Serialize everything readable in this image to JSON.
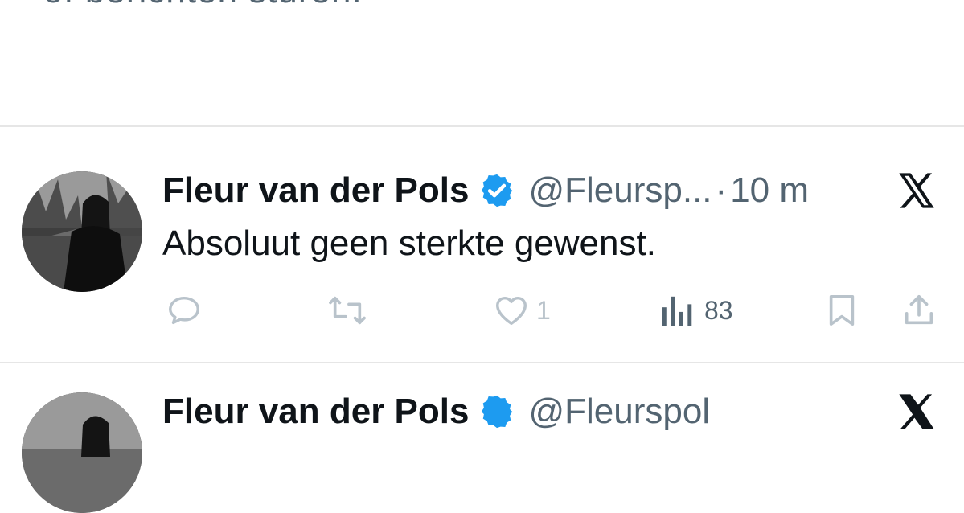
{
  "previous_text": "of berichten sturen.",
  "tweet": {
    "author_name": "Fleur van der Pols",
    "handle": "@Fleursp...",
    "separator": "·",
    "time": "10 m",
    "text": "Absoluut geen sterkte gewenst.",
    "likes": "1",
    "views": "83"
  },
  "next_tweet": {
    "author_name": "Fleur van der Pols",
    "handle": "@Fleurspol"
  },
  "icons": {
    "verified": "verified-badge-icon",
    "platform": "x-logo-icon",
    "reply": "reply-icon",
    "retweet": "retweet-icon",
    "like": "heart-icon",
    "views": "views-chart-icon",
    "bookmark": "bookmark-icon",
    "share": "share-icon"
  },
  "colors": {
    "verified_blue": "#1d9bf0",
    "text_primary": "#0f1419",
    "text_secondary": "#536471",
    "icon_muted": "#b9c3cb"
  }
}
